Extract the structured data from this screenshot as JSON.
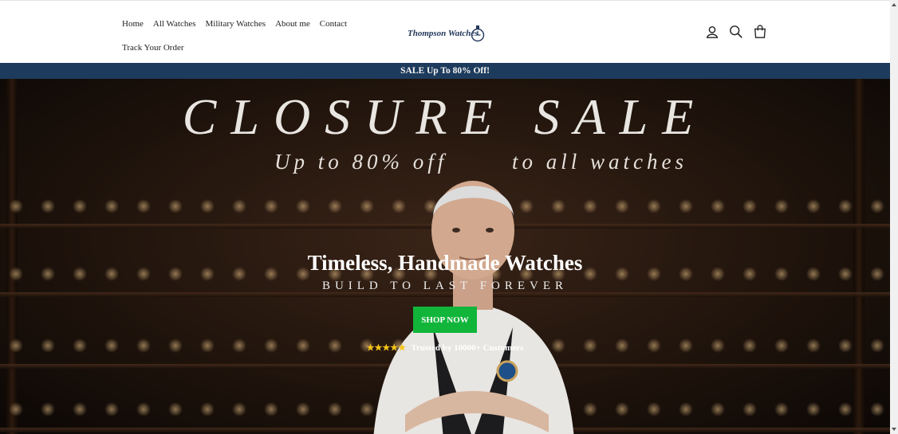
{
  "nav": {
    "items": [
      "Home",
      "All Watches",
      "Military Watches",
      "About me",
      "Contact"
    ],
    "secondary": "Track Your Order"
  },
  "logo": {
    "text": "Thompson Watches"
  },
  "icons": [
    "account-icon",
    "search-icon",
    "cart-icon"
  ],
  "announcement": "SALE Up To 80% Off!",
  "hero": {
    "title": "CLOSURE SALE",
    "subtitle_left": "Up to  80% off",
    "subtitle_right": "to all watches",
    "headline": "Timeless, Handmade Watches",
    "tagline": "BUILD TO LAST FOREVER",
    "cta": "SHOP NOW",
    "stars": "★★★★★",
    "trust": "Trusted by 10000+ Customers"
  },
  "colors": {
    "announcement_bg": "#1d3b5c",
    "cta_bg": "#11b53a",
    "logo": "#22375a"
  }
}
